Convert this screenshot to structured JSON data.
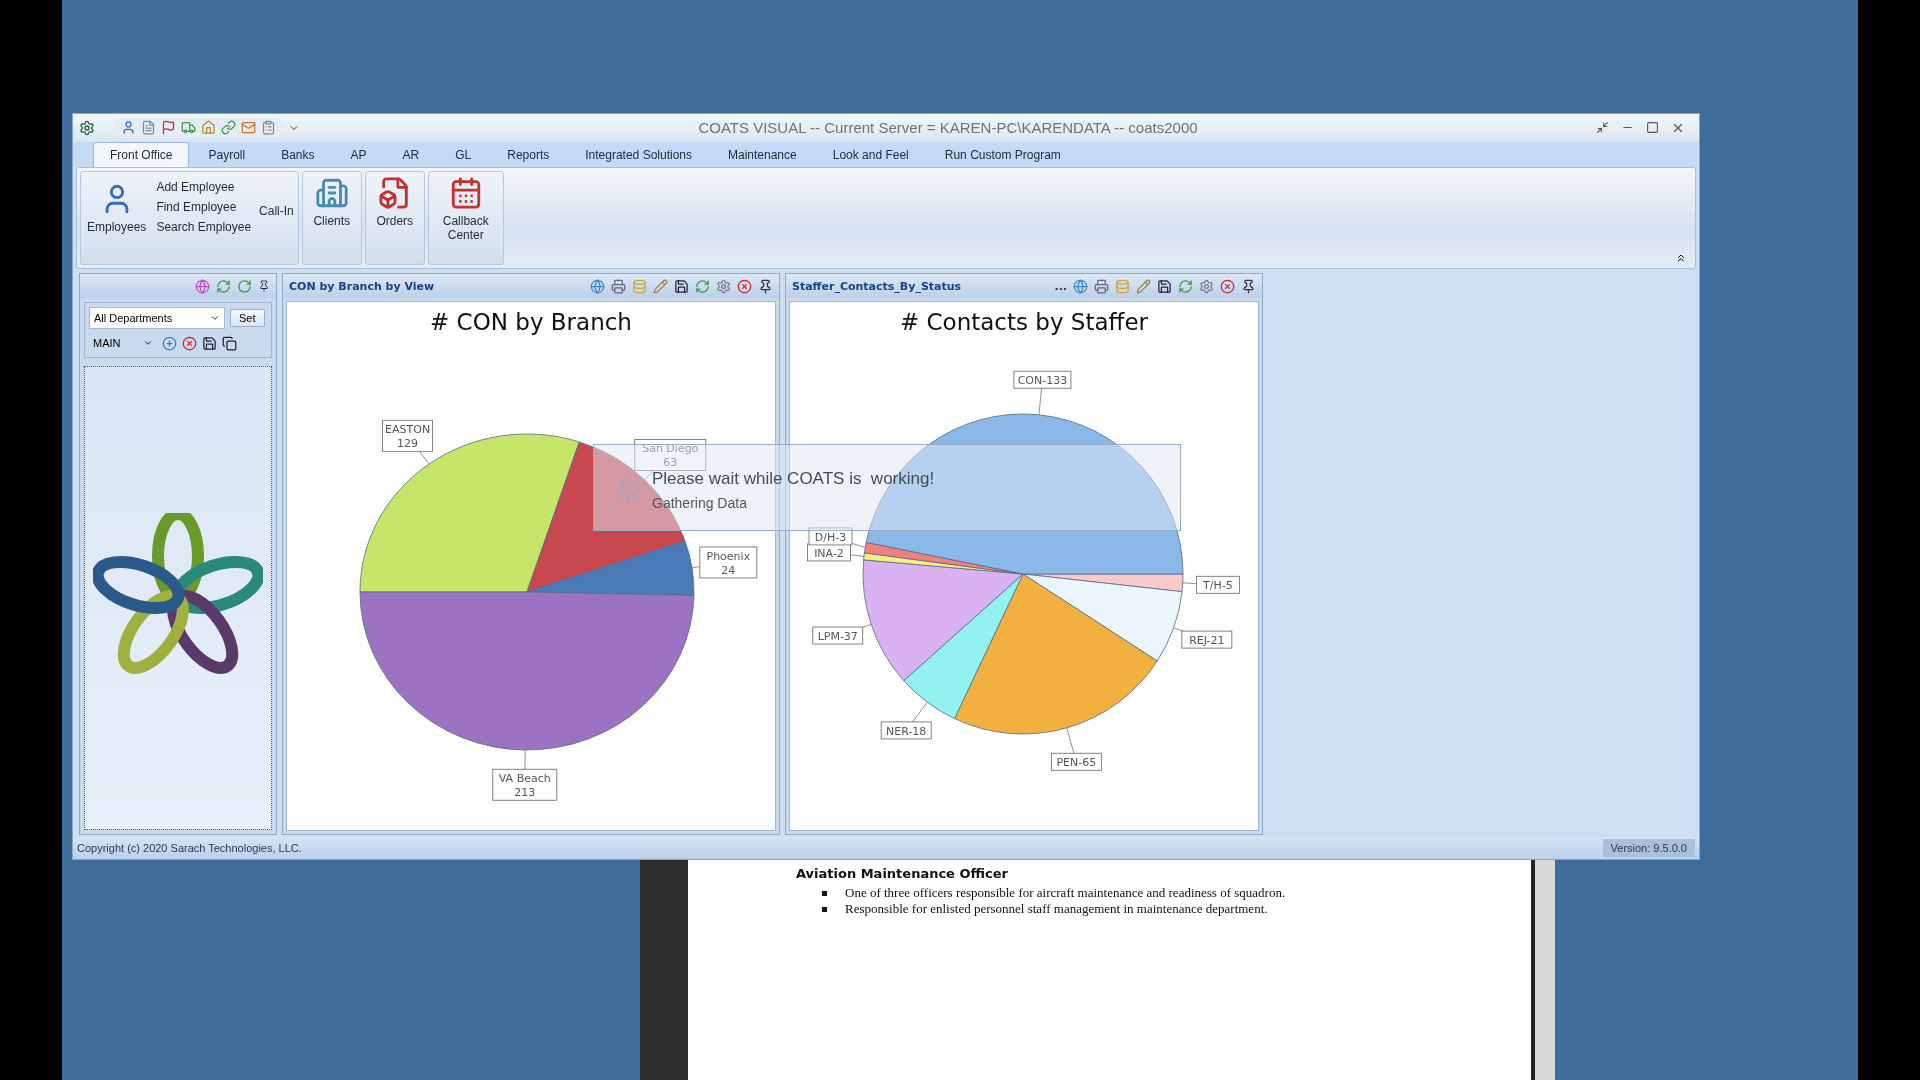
{
  "window": {
    "title": "COATS VISUAL -- Current Server = KAREN-PC\\KARENDATA -- coats2000"
  },
  "tabs": [
    {
      "label": "Front Office",
      "selected": true
    },
    {
      "label": "Payroll",
      "selected": false
    },
    {
      "label": "Banks",
      "selected": false
    },
    {
      "label": "AP",
      "selected": false
    },
    {
      "label": "AR",
      "selected": false
    },
    {
      "label": "GL",
      "selected": false
    },
    {
      "label": "Reports",
      "selected": false
    },
    {
      "label": "Integrated Solutions",
      "selected": false
    },
    {
      "label": "Maintenance",
      "selected": false
    },
    {
      "label": "Look and Feel",
      "selected": false
    },
    {
      "label": "Run Custom Program",
      "selected": false
    }
  ],
  "ribbon": {
    "groups": [
      {
        "kind": "employees",
        "label": "Employees",
        "items": [
          "Add Employee",
          "Find Employee",
          "Search Employee"
        ],
        "extra": "Call-In"
      },
      {
        "kind": "large",
        "label": "Clients"
      },
      {
        "kind": "large",
        "label": "Orders"
      },
      {
        "kind": "large",
        "label": "Callback Center"
      }
    ]
  },
  "left_panel": {
    "department": "All Departments",
    "set_button": "Set",
    "view": "MAIN"
  },
  "charts": [
    {
      "panel_title": "CON by Branch by View",
      "chart_data": {
        "type": "pie",
        "title": "# CON by Branch",
        "categories": [
          "EASTON",
          "San Diego",
          "Phoenix",
          "VA Beach"
        ],
        "values": [
          129,
          63,
          24,
          213
        ],
        "value_labels": [
          "129",
          "63",
          "24",
          "213"
        ]
      }
    },
    {
      "panel_title": "Staffer_Contacts_By_Status",
      "overflow": "...",
      "chart_data": {
        "type": "pie",
        "title": "# Contacts by Staffer",
        "categories": [
          "T/H-5",
          "REJ-21",
          "PEN-65",
          "NER-18",
          "LPM-37",
          "INA-2",
          "D/H-3",
          "CON-133"
        ],
        "values": [
          1.76,
          7.39,
          22.89,
          6.34,
          13.03,
          0.7,
          1.06,
          46.83
        ]
      }
    }
  ],
  "wait_dialog": {
    "message": "Please wait while COATS is  working!",
    "detail": "Gathering Data"
  },
  "status_bar": {
    "copyright": "Copyright (c) 2020 Sarach Technologies, LLC.",
    "version": "Version: 9.5.0.0"
  },
  "document": {
    "heading": "Aviation Maintenance Officer",
    "bullets": [
      "One of three officers responsible for aircraft maintenance and readiness of squadron.",
      "Responsible for enlisted personnel staff management in maintenance department."
    ]
  }
}
